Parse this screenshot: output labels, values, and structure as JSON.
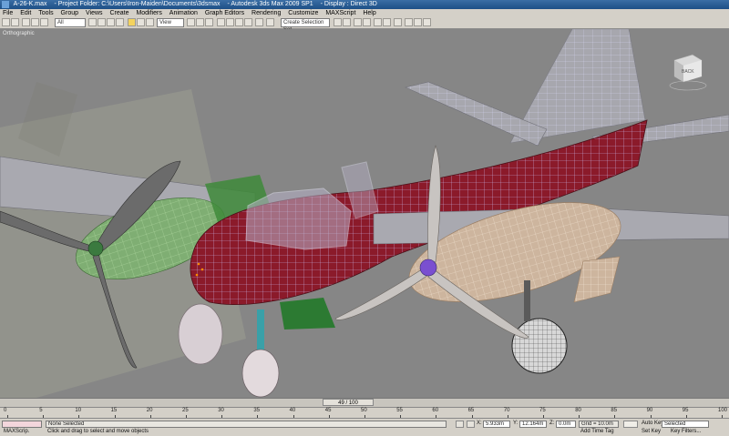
{
  "window": {
    "file": "A-26-K.max",
    "project": "- Project Folder: C:\\Users\\Iron-Maiden\\Documents\\3dsmax",
    "app": "- Autodesk 3ds Max  2009 SP1",
    "display": "- Display : Direct 3D"
  },
  "menu": [
    "File",
    "Edit",
    "Tools",
    "Group",
    "Views",
    "Create",
    "Modifiers",
    "Animation",
    "Graph Editors",
    "Rendering",
    "Customize",
    "MAXScript",
    "Help"
  ],
  "toolbar": {
    "filter": "All",
    "view": "View",
    "named_selection": "Create Selection Set"
  },
  "viewport": {
    "label": "Orthographic",
    "viewcube": "BACK"
  },
  "timeline": {
    "frame": "49 / 100",
    "ticks": [
      "0",
      "5",
      "10",
      "15",
      "20",
      "25",
      "30",
      "35",
      "40",
      "45",
      "50",
      "55",
      "60",
      "65",
      "70",
      "75",
      "80",
      "85",
      "90",
      "95",
      "100"
    ]
  },
  "status": {
    "script": "MAXScrip.",
    "selection": "None Selected",
    "prompt": "Click and drag to select and move objects",
    "x": "5.933m",
    "y": "12.164m",
    "z": "0.0m",
    "grid": "Grid = 10.0m",
    "add_time_tag": "Add Time Tag",
    "autokey": "Auto Key",
    "autokey_mode": "Selected",
    "setkey": "Set Key",
    "key_filters": "Key Filters..."
  },
  "colors": {
    "fuselage": "#8b1a2a",
    "viewport_bg": "#868686",
    "wire": "#c9c9ee",
    "propeller": "#6b6b6b",
    "selected_engine": "#e6c9a8"
  }
}
